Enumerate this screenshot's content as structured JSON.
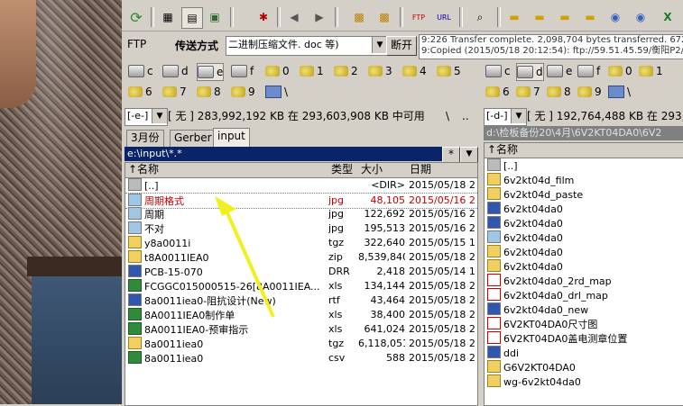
{
  "toolbar": {
    "icons": [
      "refresh-icon",
      "brief-view-icon",
      "detailed-view-icon",
      "thumbnail-view-icon",
      "invert-selection-icon",
      "back-icon",
      "forward-icon",
      "pack-icon",
      "unpack-icon",
      "ftp-connect-icon",
      "url-icon",
      "find-icon",
      "folder-1-icon",
      "folder-2-icon",
      "folder-3-icon",
      "folder-4-icon",
      "folder-5-icon",
      "folder-6-icon",
      "globe-1-icon",
      "globe-2-icon",
      "excel-icon"
    ]
  },
  "ftp": {
    "label": "FTP",
    "mode_label": "传送方式",
    "mode_value": "二进制压缩文件. doc 等)",
    "disconnect_label": "断开",
    "log_line1": "9:226 Transfer complete. 2,098,704 bytes transferred. 672.63",
    "log_line2": "9:Copied (2015/05/18 20:12:54): ftp://59.51.45.59/衡阳P2/I"
  },
  "left_drives_row1": [
    "c",
    "d",
    "e",
    "f",
    "0",
    "1",
    "2",
    "3",
    "4",
    "5"
  ],
  "left_drives_row2": [
    "6",
    "7",
    "8",
    "9",
    "\\"
  ],
  "right_drives_row1": [
    "c",
    "d",
    "e",
    "f",
    "0",
    "1"
  ],
  "right_drives_row2": [
    "6",
    "7",
    "8",
    "9",
    "\\"
  ],
  "left": {
    "drive": "[-e-]",
    "free_text": "[ 无 ]  283,992,192 KB 在 293,603,908 KB 中可用",
    "root_button": "\\",
    "up_button": "..",
    "tabs": [
      "3月份",
      "Gerber",
      "input"
    ],
    "path": "e:\\input\\*.*",
    "star": "*",
    "dropdown": "▼",
    "columns": {
      "name": "↑名称",
      "type": "类型",
      "size": "大小",
      "date": "日期"
    },
    "files": [
      {
        "name": "[..]",
        "type": "",
        "size": "<DIR>",
        "date": "2015/05/18 2",
        "icon": "up"
      },
      {
        "name": "周期格式",
        "type": "jpg",
        "size": "48,105",
        "date": "2015/05/16 2",
        "icon": "img"
      },
      {
        "name": "周期",
        "type": "jpg",
        "size": "122,692",
        "date": "2015/05/16 2",
        "icon": "img"
      },
      {
        "name": "不对",
        "type": "jpg",
        "size": "195,513",
        "date": "2015/05/16 2",
        "icon": "img"
      },
      {
        "name": "y8a0011i",
        "type": "tgz",
        "size": "322,640",
        "date": "2015/05/15 1",
        "icon": "dir"
      },
      {
        "name": "t8A0011IEA0",
        "type": "zip",
        "size": "8,539,840",
        "date": "2015/05/18 2",
        "icon": "dir"
      },
      {
        "name": "PCB-15-070",
        "type": "DRR",
        "size": "2,418",
        "date": "2015/05/14 1",
        "icon": "doc"
      },
      {
        "name": "FCGGC015000515-26[8A0011IEA...",
        "type": "xls",
        "size": "134,144",
        "date": "2015/05/18 2",
        "icon": "xls"
      },
      {
        "name": "8a0011iea0-阻抗设计(New)",
        "type": "rtf",
        "size": "43,464",
        "date": "2015/05/18 2",
        "icon": "doc"
      },
      {
        "name": "8A0011IEA0制作单",
        "type": "xls",
        "size": "38,400",
        "date": "2015/05/18 2",
        "icon": "xls"
      },
      {
        "name": "8A0011IEA0-预审指示",
        "type": "xls",
        "size": "641,024",
        "date": "2015/05/18 2",
        "icon": "xls"
      },
      {
        "name": "8a0011iea0",
        "type": "tgz",
        "size": "6,118,051",
        "date": "2015/05/18 2",
        "icon": "dir"
      },
      {
        "name": "8a0011iea0",
        "type": "csv",
        "size": "588",
        "date": "2015/05/18 2",
        "icon": "xls"
      }
    ]
  },
  "right": {
    "drive": "[-d-]",
    "free_text": "[ 无 ]  192,764,488 KB 在 293,603,908",
    "path": "d:\\检板备份20\\4月\\6V2KT04DA0\\6V2",
    "columns": {
      "name": "↑名称"
    },
    "files": [
      {
        "name": "[..]",
        "icon": "up"
      },
      {
        "name": "6v2kt04d_film",
        "icon": "dir"
      },
      {
        "name": "6v2kt04d_paste",
        "icon": "dir"
      },
      {
        "name": "6v2kt04da0",
        "icon": "doc"
      },
      {
        "name": "6v2kt04da0",
        "icon": "doc"
      },
      {
        "name": "6v2kt04da0",
        "icon": "img"
      },
      {
        "name": "6v2kt04da0",
        "icon": "dir"
      },
      {
        "name": "6v2kt04da0",
        "icon": "dir"
      },
      {
        "name": "6v2kt04da0_2rd_map",
        "icon": "pdf"
      },
      {
        "name": "6v2kt04da0_drl_map",
        "icon": "pdf"
      },
      {
        "name": "6v2kt04da0_new",
        "icon": "doc"
      },
      {
        "name": "6V2KT04DA0尺寸图",
        "icon": "pdf"
      },
      {
        "name": "6V2KT04DA0盖电测章位置",
        "icon": "pdf"
      },
      {
        "name": "ddi",
        "icon": "doc"
      },
      {
        "name": "G6V2KT04DA0",
        "icon": "dir"
      },
      {
        "name": "wg-6v2kt04da0",
        "icon": "dir"
      }
    ]
  },
  "colors": {
    "highlight_text": "#c00000",
    "selection": "#0a246a",
    "annotation_arrow": "#f0f020"
  }
}
